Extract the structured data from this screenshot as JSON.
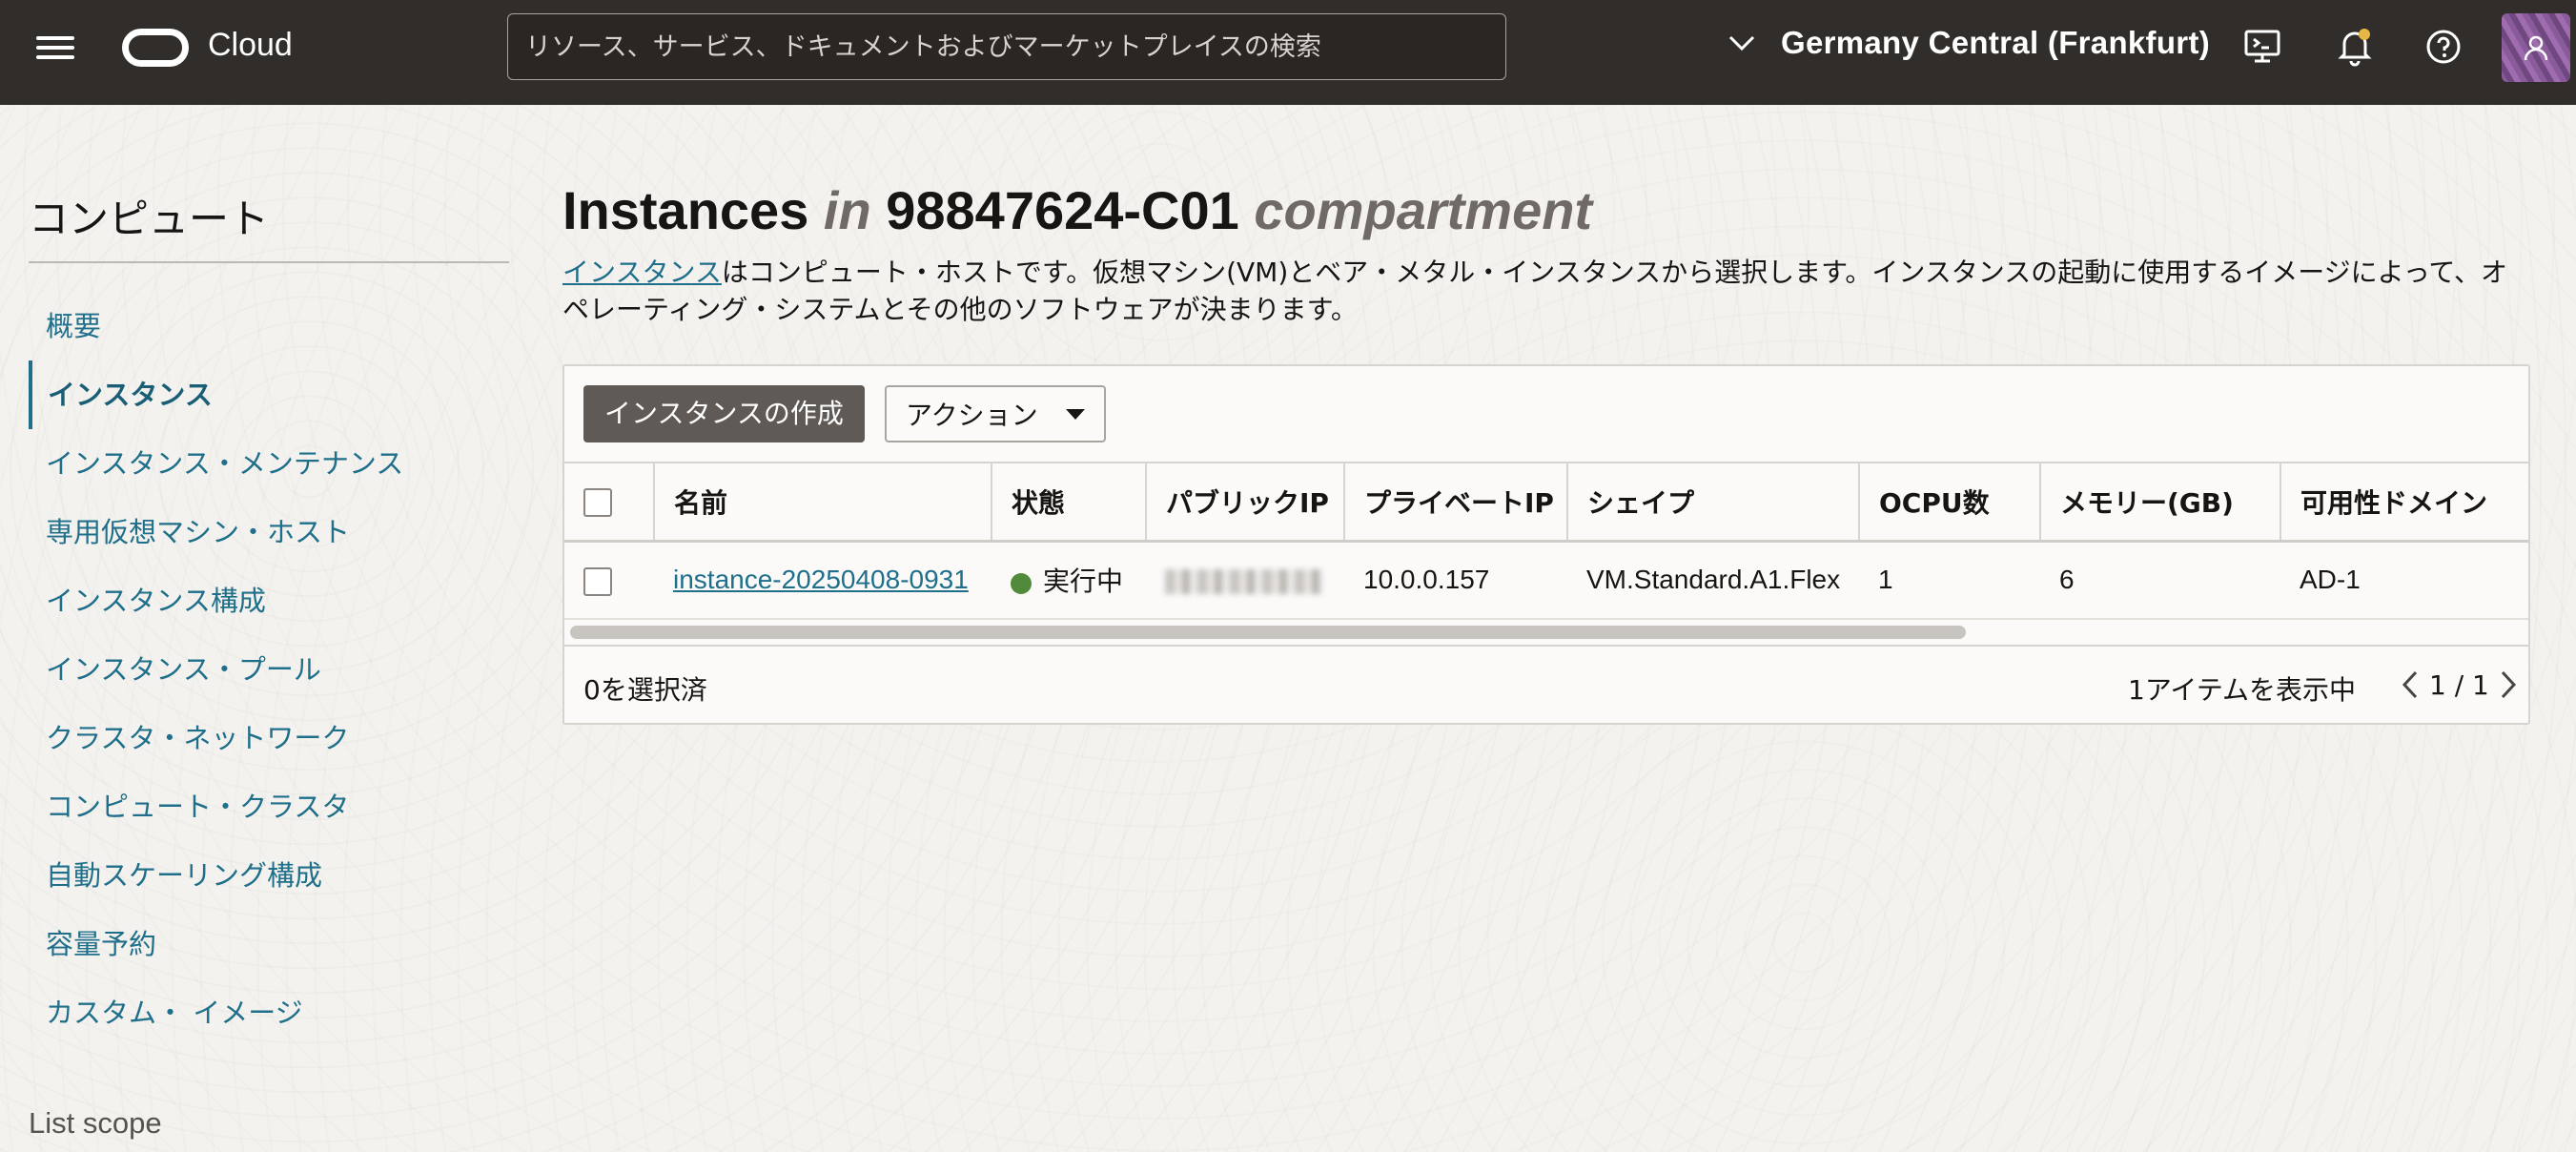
{
  "header": {
    "brand": "Cloud",
    "search_placeholder": "リソース、サービス、ドキュメントおよびマーケットプレイスの検索",
    "region": "Germany Central (Frankfurt)"
  },
  "sidebar": {
    "title": "コンピュート",
    "items": [
      {
        "label": "概要"
      },
      {
        "label": "インスタンス",
        "active": true
      },
      {
        "label": "インスタンス・メンテナンス"
      },
      {
        "label": "専用仮想マシン・ホスト"
      },
      {
        "label": "インスタンス構成"
      },
      {
        "label": "インスタンス・プール"
      },
      {
        "label": "クラスタ・ネットワーク"
      },
      {
        "label": "コンピュート・クラスタ"
      },
      {
        "label": "自動スケーリング構成"
      },
      {
        "label": "容量予約"
      },
      {
        "label": "カスタム・ イメージ"
      }
    ],
    "list_scope": "List scope"
  },
  "page": {
    "title_main": "Instances",
    "title_in": "in",
    "title_compartment": "98847624-C01",
    "title_suffix": "compartment",
    "desc_link": "インスタンス",
    "desc_rest": "はコンピュート・ホストです。仮想マシン(VM)とベア・メタル・インスタンスから選択します。インスタンスの起動に使用するイメージによって、オペレーティング・システムとその他のソフトウェアが決まります。"
  },
  "toolbar": {
    "create_label": "インスタンスの作成",
    "actions_label": "アクション"
  },
  "table": {
    "columns": [
      "名前",
      "状態",
      "パブリックIP",
      "プライベートIP",
      "シェイプ",
      "OCPU数",
      "メモリー(GB)",
      "可用性ドメイン"
    ],
    "rows": [
      {
        "name": "instance-20250408-0931",
        "state": "実行中",
        "public_ip": "",
        "private_ip": "10.0.0.157",
        "shape": "VM.Standard.A1.Flex",
        "ocpu": "1",
        "memory": "6",
        "ad": "AD-1"
      }
    ]
  },
  "footer": {
    "selected": "0を選択済",
    "items_shown": "1アイテムを表示中",
    "page": "1 / 1"
  },
  "colors": {
    "header_bg": "#312d2a",
    "link": "#1f6f8b",
    "status_running": "#508a3a",
    "primary_button": "#5f5a55"
  }
}
